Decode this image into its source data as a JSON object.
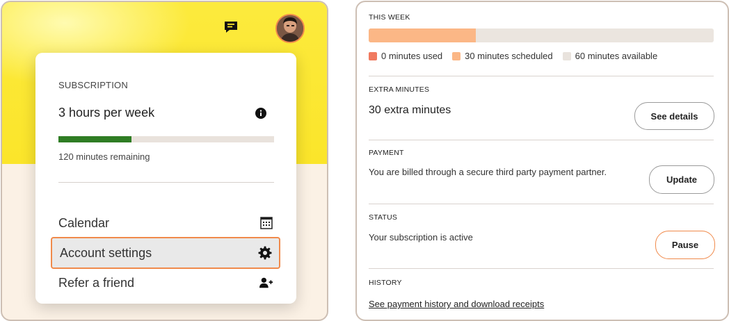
{
  "header": {
    "chat_icon": "chat-icon",
    "avatar_icon": "user-avatar"
  },
  "menu": {
    "subscription_label": "SUBSCRIPTION",
    "plan": "3 hours per week",
    "info_icon": "info-icon",
    "remaining_progress_fraction": 0.34,
    "remaining_text": "120 minutes remaining",
    "items": [
      {
        "label": "Calendar",
        "icon": "calendar-icon"
      },
      {
        "label": "Account settings",
        "icon": "gear-icon",
        "selected": true
      },
      {
        "label": "Refer a friend",
        "icon": "add-person-icon"
      }
    ]
  },
  "this_week": {
    "label": "THIS WEEK",
    "scheduled_fraction": 0.31,
    "legend": [
      {
        "text": "0 minutes used",
        "color": "#f07a60"
      },
      {
        "text": "30 minutes scheduled",
        "color": "#fbb786"
      },
      {
        "text": "60 minutes available",
        "color": "#e9e3dd"
      }
    ]
  },
  "extra_minutes": {
    "label": "EXTRA MINUTES",
    "value": "30 extra minutes",
    "button": "See details"
  },
  "payment": {
    "label": "PAYMENT",
    "text": "You are billed through a secure third party payment partner.",
    "button": "Update"
  },
  "status": {
    "label": "STATUS",
    "text": "Your subscription is active",
    "button": "Pause"
  },
  "history": {
    "label": "HISTORY",
    "link": "See payment history and download receipts"
  },
  "colors": {
    "accent": "#f08a4b",
    "progress_green": "#2f7d24",
    "yellow": "#fbe52a"
  }
}
